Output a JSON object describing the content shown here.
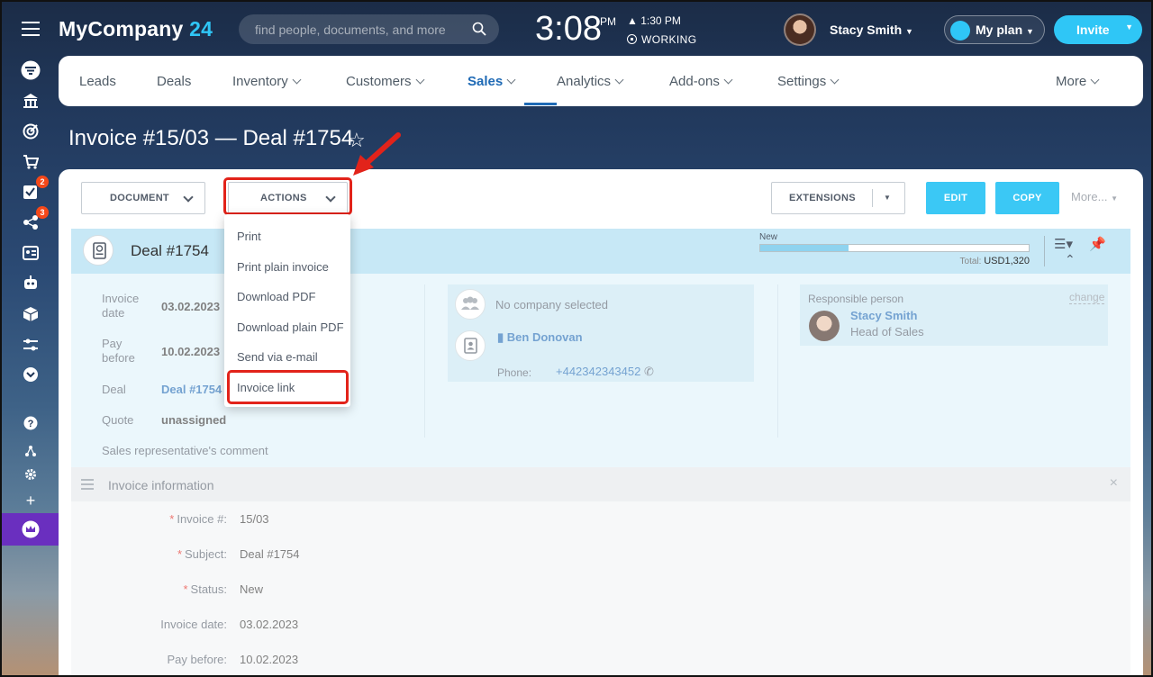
{
  "topbar": {
    "company": "MyCompany",
    "company_num": "24",
    "search_placeholder": "find people, documents, and more",
    "time": "3:08",
    "ampm": "PM",
    "alarm": "1:30 PM",
    "status": "WORKING",
    "user": "Stacy Smith",
    "plan": "My plan",
    "invite": "Invite"
  },
  "sidebar": {
    "badges": [
      "2",
      "3"
    ]
  },
  "nav": {
    "items": [
      "Leads",
      "Deals",
      "Inventory",
      "Customers",
      "Sales",
      "Analytics",
      "Add-ons",
      "Settings",
      "More"
    ],
    "active": "Sales"
  },
  "page": {
    "title": "Invoice #15/03 — Deal #1754"
  },
  "toolbar": {
    "document": "DOCUMENT",
    "actions": "ACTIONS",
    "extensions": "EXTENSIONS",
    "edit": "EDIT",
    "copy": "COPY",
    "more": "More..."
  },
  "actions_menu": [
    "Print",
    "Print plain invoice",
    "Download PDF",
    "Download plain PDF",
    "Send via e-mail",
    "Invoice link"
  ],
  "deal": {
    "title": "Deal #1754",
    "stage": "New",
    "progress": 0.33,
    "total_label": "Total:",
    "total_value": "USD1,320",
    "fields": [
      {
        "label": "Invoice date",
        "value": "03.02.2023"
      },
      {
        "label": "Pay before",
        "value": "10.02.2023"
      },
      {
        "label": "Deal",
        "value": "Deal #1754"
      },
      {
        "label": "Quote",
        "value": "unassigned"
      }
    ],
    "comment_label": "Sales representative's comment",
    "company": "No company selected",
    "contact_name": "Ben Donovan",
    "phone_label": "Phone:",
    "phone": "+442342343452",
    "responsible_label": "Responsible person",
    "change": "change",
    "responsible_name": "Stacy Smith",
    "responsible_role": "Head of Sales"
  },
  "invoice_info": {
    "title": "Invoice information",
    "rows": [
      {
        "label": "Invoice #:",
        "value": "15/03",
        "required": true
      },
      {
        "label": "Subject:",
        "value": "Deal #1754",
        "required": true
      },
      {
        "label": "Status:",
        "value": "New",
        "required": true
      },
      {
        "label": "Invoice date:",
        "value": "03.02.2023",
        "required": false
      },
      {
        "label": "Pay before:",
        "value": "10.02.2023",
        "required": false
      }
    ]
  },
  "colors": {
    "accent": "#2fc6f6",
    "highlight": "#e2231a",
    "link": "#1f6ab5"
  }
}
